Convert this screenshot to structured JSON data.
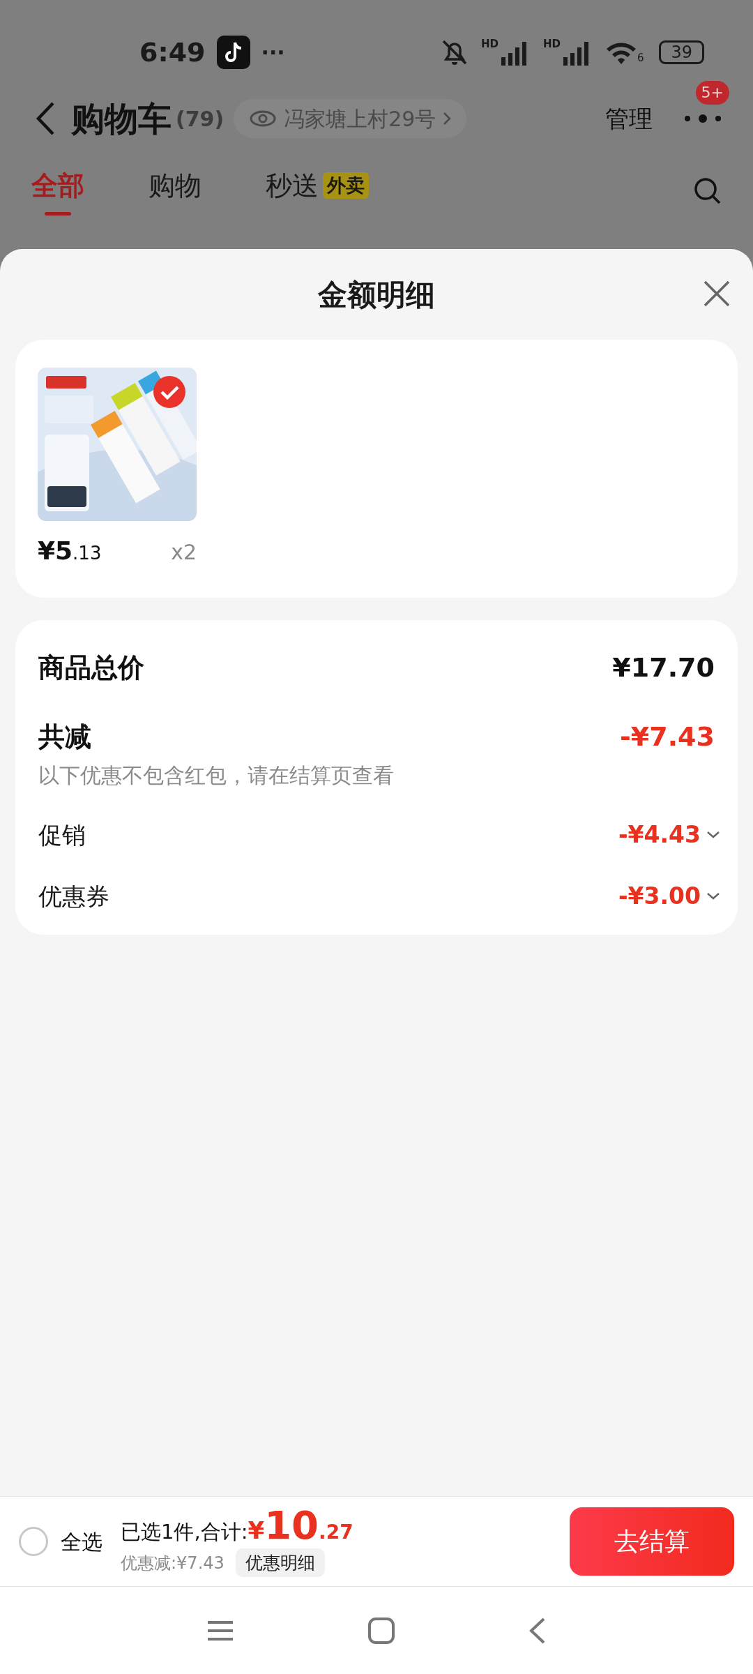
{
  "status_bar": {
    "time": "6:49",
    "more": "···",
    "signal_labels": [
      "HD",
      "HD"
    ],
    "wifi_label": "6",
    "battery": "39"
  },
  "header": {
    "title": "购物车",
    "count": "(79)",
    "address": "冯家塘上村29号",
    "manage": "管理",
    "badge": "5+"
  },
  "tabs": [
    {
      "label": "全部",
      "selected": true
    },
    {
      "label": "购物",
      "selected": false
    },
    {
      "label": "秒送",
      "tag": "外卖",
      "selected": false
    }
  ],
  "sheet": {
    "title": "金额明细",
    "items": [
      {
        "kind": "picture",
        "selected": true,
        "price_main": "¥5",
        "price_decimal": ".13",
        "quantity": "x2"
      }
    ],
    "summary": {
      "total_label": "商品总价",
      "total": "¥17.70",
      "discount_label": "共减",
      "discount": "-¥7.43",
      "note": "以下优惠不包含红包，请在结算页查看",
      "rows": [
        {
          "label": "促销",
          "amount": "-¥4.43"
        },
        {
          "label": "优惠券",
          "amount": "-¥3.00"
        }
      ]
    }
  },
  "bottom_bar": {
    "select_all": {
      "label": "全选",
      "checked": false
    },
    "selected_text": "已选1件,合计:",
    "currency": "¥",
    "total_main": "10",
    "total_decimal": ".27",
    "saving": "优惠减:¥7.43",
    "detail_button": "优惠明细",
    "checkout": "去结算"
  }
}
